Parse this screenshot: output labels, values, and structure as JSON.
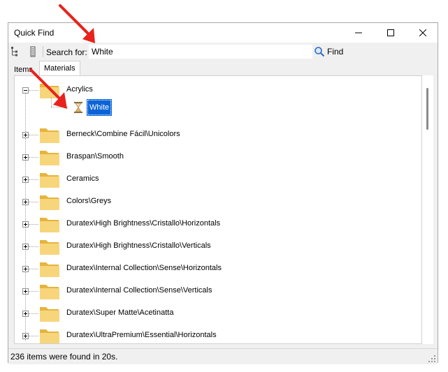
{
  "window": {
    "title": "Quick Find",
    "controls": {
      "minimize_icon": "minimize-icon",
      "maximize_icon": "maximize-icon",
      "close_icon": "close-icon"
    }
  },
  "toolbar": {
    "icons": [
      "tree-view-icon",
      "list-view-icon"
    ],
    "search_label": "Search for:",
    "search_value": "White",
    "find_label": "Find",
    "find_icon": "magnifier-icon"
  },
  "tabs": [
    {
      "label": "Items",
      "active": false
    },
    {
      "label": "Materials",
      "active": true
    }
  ],
  "tree": {
    "expanded_node": {
      "label": "Acrylics",
      "children": [
        {
          "label": "White",
          "selected": true,
          "icon": "hourglass-icon"
        }
      ]
    },
    "nodes": [
      "Berneck\\Combine Fácil\\Unicolors",
      "Braspan\\Smooth",
      "Ceramics",
      "Colors\\Greys",
      "Duratex\\High Brightness\\Cristallo\\Horizontals",
      "Duratex\\High Brightness\\Cristallo\\Verticals",
      "Duratex\\Internal Collection\\Sense\\Horizontals",
      "Duratex\\Internal Collection\\Sense\\Verticals",
      "Duratex\\Super Matte\\Acetinatta",
      "Duratex\\UltraPremium\\Essential\\Horizontals"
    ]
  },
  "status": {
    "text": "236 items were found in 20s."
  },
  "colors": {
    "selection": "#0a64d8",
    "folder": "#f2c94c",
    "annotation_arrow": "#e8221c"
  }
}
